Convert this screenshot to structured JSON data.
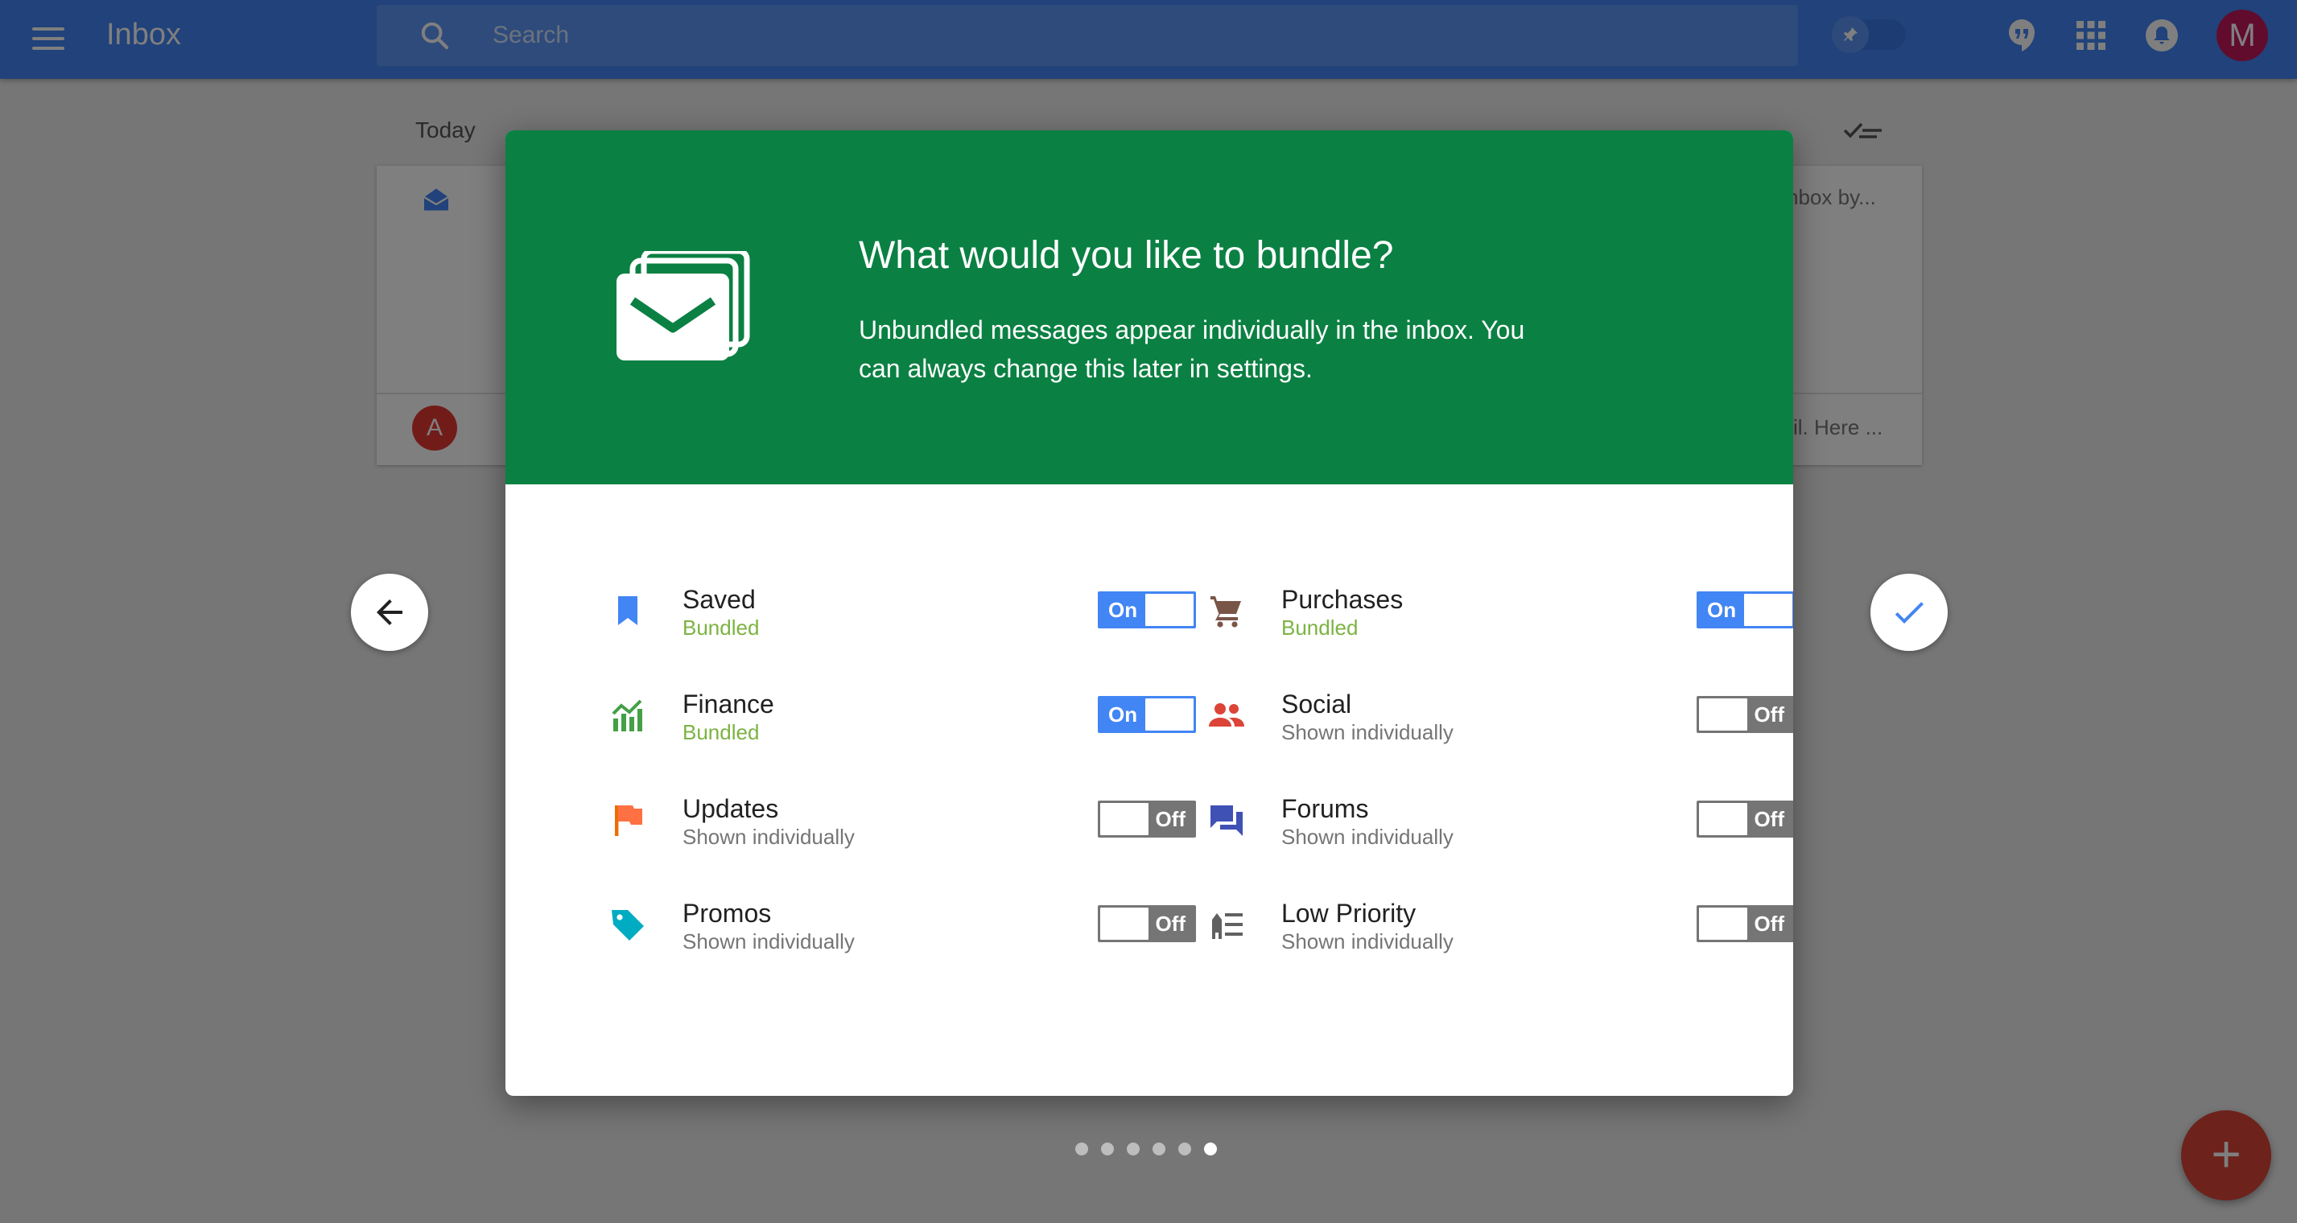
{
  "header": {
    "app_title": "Inbox",
    "search_placeholder": "Search",
    "avatar_letter": "M",
    "brand_color": "#4285f4"
  },
  "list": {
    "section_label": "Today",
    "row1_snippet": "nbox by...",
    "row2_avatar_letter": "A",
    "row2_snippet": "il. Here ..."
  },
  "dialog": {
    "title": "What would you like to bundle?",
    "description": "Unbundled messages appear individually in the inbox. You can always change this later in settings.",
    "header_color": "#0b8043",
    "options": [
      {
        "name": "Saved",
        "status": "Bundled",
        "toggle": "On",
        "icon": "bookmark-icon",
        "color": "#4285f4"
      },
      {
        "name": "Purchases",
        "status": "Bundled",
        "toggle": "On",
        "icon": "cart-icon",
        "color": "#795548"
      },
      {
        "name": "Finance",
        "status": "Bundled",
        "toggle": "On",
        "icon": "finance-chart-icon",
        "color": "#0b8043"
      },
      {
        "name": "Social",
        "status": "Shown individually",
        "toggle": "Off",
        "icon": "people-icon",
        "color": "#db4437"
      },
      {
        "name": "Updates",
        "status": "Shown individually",
        "toggle": "Off",
        "icon": "flag-icon",
        "color": "#ef6c00"
      },
      {
        "name": "Forums",
        "status": "Shown individually",
        "toggle": "Off",
        "icon": "forum-icon",
        "color": "#3f51b5"
      },
      {
        "name": "Promos",
        "status": "Shown individually",
        "toggle": "Off",
        "icon": "tag-icon",
        "color": "#00acc1"
      },
      {
        "name": "Low Priority",
        "status": "Shown individually",
        "toggle": "Off",
        "icon": "low-priority-icon",
        "color": "#616161"
      }
    ]
  },
  "pagination": {
    "count": 6,
    "active": 6
  },
  "fab_label": "+"
}
